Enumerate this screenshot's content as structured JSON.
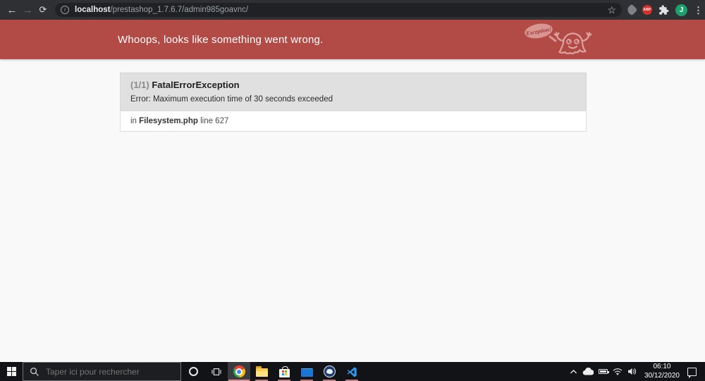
{
  "browser": {
    "url_host": "localhost",
    "url_path": "/prestashop_1.7.6.7/admin985goavnc/",
    "info_glyph": "i",
    "star_glyph": "☆",
    "adblock_label": "ABP",
    "profile_initial": "J",
    "menu_glyph": "⋮",
    "back_glyph": "←",
    "forward_glyph": "→",
    "reload_glyph": "⟳"
  },
  "page": {
    "banner_title": "Whoops, looks like something went wrong.",
    "ghost_bubble_text": "Exception!",
    "error": {
      "index": "(1/1)",
      "exception_name": "FatalErrorException",
      "message": "Error: Maximum execution time of 30 seconds exceeded",
      "location_prefix": "in",
      "location_file": "Filesystem.php",
      "location_line": "line 627"
    }
  },
  "taskbar": {
    "search_placeholder": "Taper ici pour rechercher",
    "clock_time": "06:10",
    "clock_date": "30/12/2020"
  },
  "colors": {
    "banner_red": "#b24a46",
    "ghost_pink": "#dda29e",
    "taskbar_bg": "#121316",
    "active_underline": "#e0918d"
  }
}
